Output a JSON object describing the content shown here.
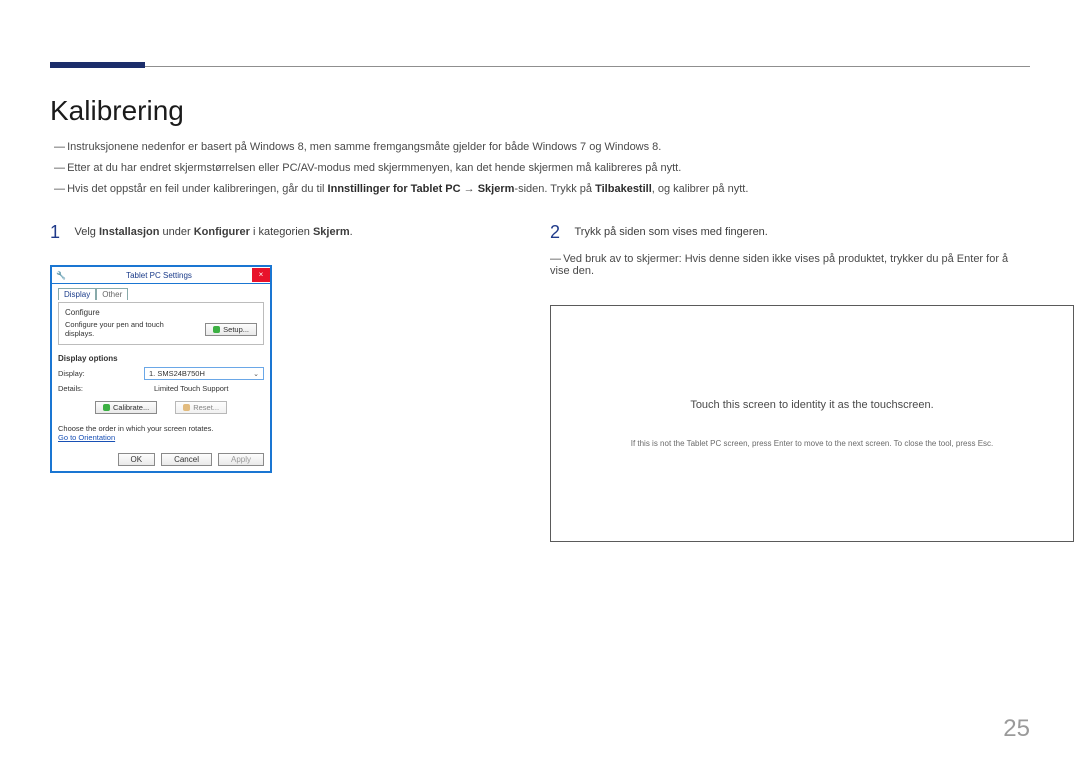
{
  "header": {
    "accent_color": "#1c2e6b"
  },
  "title": "Kalibrering",
  "intro": {
    "line1": "Instruksjonene nedenfor er basert på Windows 8, men samme fremgangsmåte gjelder for både Windows 7 og Windows 8.",
    "line2": "Etter at du har endret skjermstørrelsen eller PC/AV-modus med skjermmenyen, kan det hende skjermen må kalibreres på nytt.",
    "line3_a": "Hvis det oppstår en feil under kalibreringen, går du til ",
    "line3_b1": "Innstillinger for Tablet PC",
    "line3_arrow": " → ",
    "line3_b2": "Skjerm",
    "line3_c": "-siden. Trykk på ",
    "line3_b3": "Tilbakestill",
    "line3_d": ", og kalibrer på nytt."
  },
  "steps": {
    "one": {
      "num": "1",
      "pre": "Velg ",
      "b1": "Installasjon",
      "mid1": " under ",
      "b2": "Konfigurer",
      "mid2": " i kategorien ",
      "b3": "Skjerm",
      "post": "."
    },
    "two": {
      "num": "2",
      "text": "Trykk på siden som vises med fingeren.",
      "note": "Ved bruk av to skjermer: Hvis denne siden ikke vises på produktet, trykker du på Enter for å vise den."
    }
  },
  "dialog": {
    "title": "Tablet PC Settings",
    "close": "×",
    "tabs": {
      "display": "Display",
      "other": "Other"
    },
    "configure": {
      "label": "Configure",
      "desc": "Configure your pen and touch displays.",
      "setup": "Setup..."
    },
    "display_options": {
      "label": "Display options",
      "display_label": "Display:",
      "display_value": "1. SMS24B750H",
      "details_label": "Details:",
      "details_value": "Limited Touch Support",
      "calibrate": "Calibrate...",
      "reset": "Reset..."
    },
    "rotate": {
      "text": "Choose the order in which your screen rotates.",
      "link": "Go to Orientation"
    },
    "footer": {
      "ok": "OK",
      "cancel": "Cancel",
      "apply": "Apply"
    }
  },
  "touchscreen": {
    "main": "Touch this screen to identity it as the touchscreen.",
    "sub": "If this is not the Tablet PC screen, press Enter to move to the next screen. To close the tool, press Esc."
  },
  "page_number": "25"
}
